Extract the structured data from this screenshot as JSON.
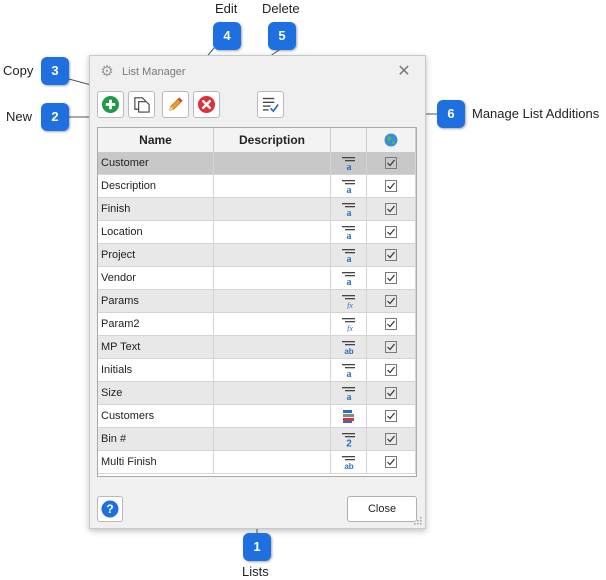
{
  "dialog": {
    "title": "List Manager",
    "close_glyph": "✕",
    "gear_icon": "gear-icon"
  },
  "toolbar": {
    "buttons": [
      {
        "name": "new-button",
        "icon": "plus-circle-icon",
        "color": "#1e9a4a"
      },
      {
        "name": "copy-button",
        "icon": "copy-icon"
      },
      {
        "name": "edit-button",
        "icon": "pencil-icon",
        "color": "#f0a020"
      },
      {
        "name": "delete-button",
        "icon": "x-circle-icon",
        "color": "#e0303a"
      },
      {
        "name": "manage-list-additions-button",
        "icon": "list-check-icon"
      }
    ]
  },
  "grid": {
    "columns": [
      "Name",
      "Description",
      "",
      ""
    ],
    "globe_icon": "globe-icon",
    "rows": [
      {
        "name": "Customer",
        "description": "",
        "type_icon": "text-list-icon",
        "checked": true,
        "selected": true
      },
      {
        "name": "Description",
        "description": "",
        "type_icon": "text-list-icon",
        "checked": true
      },
      {
        "name": "Finish",
        "description": "",
        "type_icon": "text-list-icon",
        "checked": true
      },
      {
        "name": "Location",
        "description": "",
        "type_icon": "text-list-icon",
        "checked": true
      },
      {
        "name": "Project",
        "description": "",
        "type_icon": "text-list-icon",
        "checked": true
      },
      {
        "name": "Vendor",
        "description": "",
        "type_icon": "text-list-icon",
        "checked": true
      },
      {
        "name": "Params",
        "description": "",
        "type_icon": "function-list-icon",
        "checked": true
      },
      {
        "name": "Param2",
        "description": "",
        "type_icon": "function-list-icon",
        "checked": true
      },
      {
        "name": "MP Text",
        "description": "",
        "type_icon": "multi-text-list-icon",
        "checked": true
      },
      {
        "name": "Initials",
        "description": "",
        "type_icon": "text-list-icon",
        "checked": true
      },
      {
        "name": "Size",
        "description": "",
        "type_icon": "text-list-icon",
        "checked": true
      },
      {
        "name": "Customers",
        "description": "",
        "type_icon": "table-list-icon",
        "checked": true
      },
      {
        "name": "Bin #",
        "description": "",
        "type_icon": "number-list-icon",
        "checked": true
      },
      {
        "name": "Multi Finish",
        "description": "",
        "type_icon": "multi-text-list-icon",
        "checked": true
      }
    ]
  },
  "footer": {
    "help_glyph": "?",
    "close_label": "Close"
  },
  "callouts": [
    {
      "number": "1",
      "label": "Lists"
    },
    {
      "number": "2",
      "label": "New"
    },
    {
      "number": "3",
      "label": "Copy"
    },
    {
      "number": "4",
      "label": "Edit"
    },
    {
      "number": "5",
      "label": "Delete"
    },
    {
      "number": "6",
      "label": "Manage List Additions"
    }
  ],
  "colors": {
    "callout_blue": "#1e6fe0",
    "selected_row": "#c8c8c8",
    "alt_row": "#e8e8e8",
    "icon_blue": "#2a6fc0"
  }
}
